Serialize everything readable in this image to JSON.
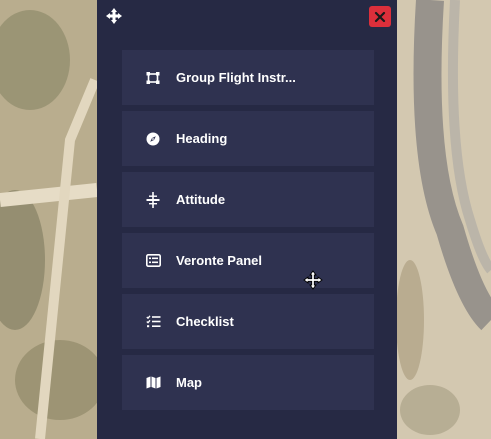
{
  "colors": {
    "panel_bg": "#262944",
    "item_bg": "#2f3250",
    "close_bg": "#dc2f3b",
    "text": "#ffffff"
  },
  "header": {
    "move_icon": "move-arrows-icon",
    "close_icon": "close-x-icon"
  },
  "menu": {
    "items": [
      {
        "label": "Group Flight Instr...",
        "icon": "group-frame-icon"
      },
      {
        "label": "Heading",
        "icon": "compass-icon"
      },
      {
        "label": "Attitude",
        "icon": "attitude-indicator-icon"
      },
      {
        "label": "Veronte Panel",
        "icon": "table-panel-icon"
      },
      {
        "label": "Checklist",
        "icon": "checklist-icon"
      },
      {
        "label": "Map",
        "icon": "map-icon"
      }
    ]
  },
  "cursor": {
    "icon": "move-cursor-icon"
  }
}
